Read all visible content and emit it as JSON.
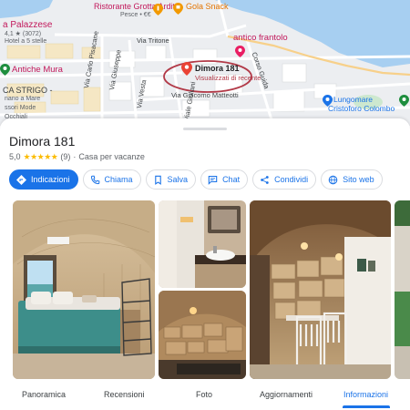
{
  "map": {
    "poi_palazzese_name": "a Palazzese",
    "poi_palazzese_rating": "4,1 ★ (3072)",
    "poi_palazzese_sub": "Hotel a 5 stelle",
    "poi_grotta_name": "Ristorante Grotta Ardito",
    "poi_grotta_sub": "Pesce • €€",
    "poi_gola_name": "Gola Snack",
    "poi_frantolo_name": "antico frantolo",
    "poi_mura_name": "Antiche Mura",
    "poi_strigo_lines": [
      "CA STRIGO -",
      "nano a Mare",
      "ssori Mode",
      "Occhiali"
    ],
    "road_tritone": "Via Tritone",
    "road_carlo": "Via Carlo Pisacane",
    "road_giuseppe": "Via Giuseppe",
    "road_vesta": "Via Vesta",
    "road_matteotti": "Via Giacomo Matteotti",
    "road_guida": "Corso Guida",
    "road_giuliani": "Viale Giuliani",
    "dimora_title": "Dimora 181",
    "dimora_sub": "Visualizzati di recente",
    "lungomare_1": "Lungomare",
    "lungomare_2": "Cristoforo Colombo"
  },
  "place": {
    "name": "Dimora 181",
    "rating": "5,0",
    "stars": "★★★★★",
    "reviews": "(9)",
    "type": "Casa per vacanze"
  },
  "actions": [
    {
      "label": "Indicazioni",
      "icon": "directions-icon"
    },
    {
      "label": "Chiama",
      "icon": "phone-icon"
    },
    {
      "label": "Salva",
      "icon": "bookmark-icon"
    },
    {
      "label": "Chat",
      "icon": "chat-icon"
    },
    {
      "label": "Condividi",
      "icon": "share-icon"
    },
    {
      "label": "Sito web",
      "icon": "globe-icon"
    }
  ],
  "tabs": [
    {
      "label": "Panoramica"
    },
    {
      "label": "Recensioni"
    },
    {
      "label": "Foto"
    },
    {
      "label": "Aggiornamenti"
    },
    {
      "label": "Informazioni",
      "active": true
    }
  ],
  "colors": {
    "accent": "#1a73e8",
    "star": "#fbbc04",
    "poi": "#c2185b",
    "sea": "#a7cff1"
  }
}
